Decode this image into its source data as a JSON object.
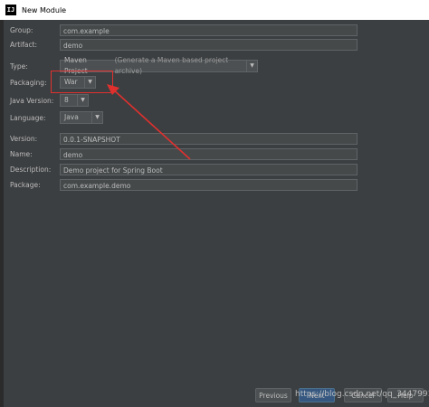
{
  "window": {
    "title": "New Module",
    "icon": "intellij-icon"
  },
  "form": {
    "group": {
      "label": "Group:",
      "value": "com.example"
    },
    "artifact": {
      "label": "Artifact:",
      "value": "demo"
    },
    "type": {
      "label": "Type:",
      "value": "Maven Project",
      "hint": "(Generate a Maven based project archive)"
    },
    "packaging": {
      "label": "Packaging:",
      "value": "War"
    },
    "java_version": {
      "label": "Java Version:",
      "value": "8"
    },
    "language": {
      "label": "Language:",
      "value": "Java"
    },
    "version": {
      "label": "Version:",
      "value": "0.0.1-SNAPSHOT"
    },
    "name": {
      "label": "Name:",
      "value": "demo"
    },
    "description": {
      "label": "Description:",
      "value": "Demo project for Spring Boot"
    },
    "package": {
      "label": "Package:",
      "value": "com.example.demo"
    }
  },
  "buttons": {
    "previous": "Previous",
    "next": "Next",
    "cancel": "Cancel",
    "help": "Help"
  },
  "watermark": "https://blog.csdn.net/qq_34479912",
  "colors": {
    "annotation": "#e0302e",
    "background": "#3c3f41"
  }
}
